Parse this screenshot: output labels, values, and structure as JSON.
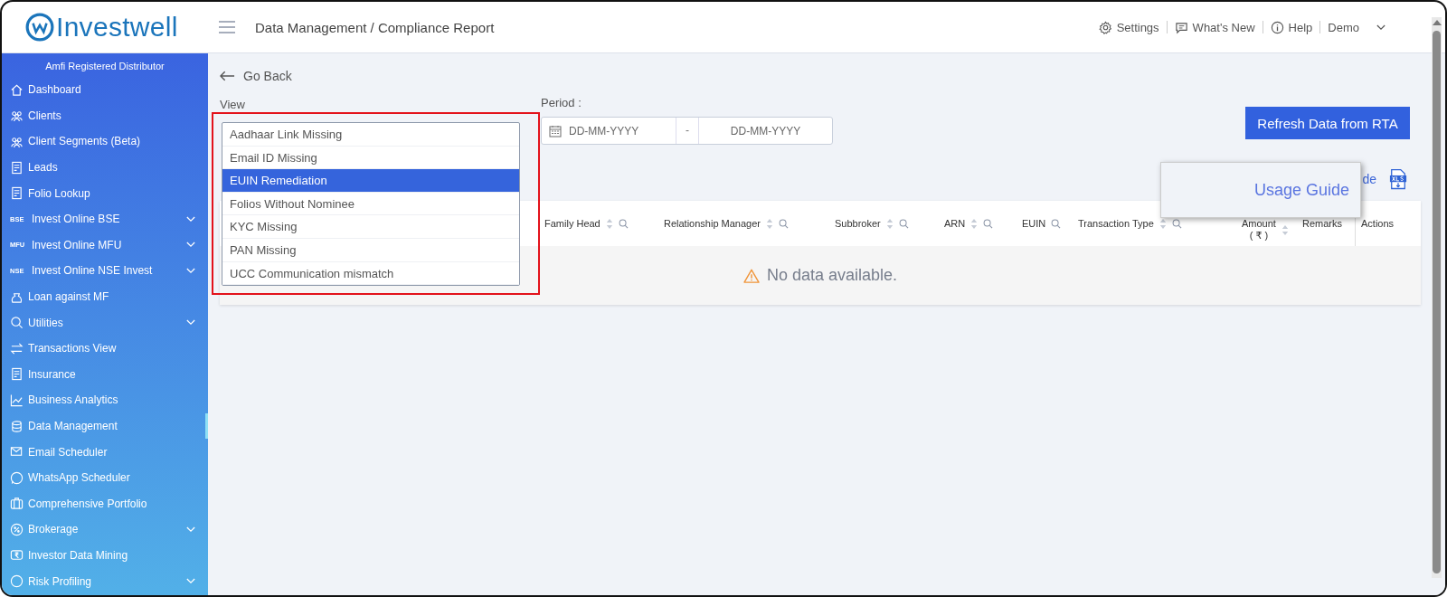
{
  "header": {
    "logo": "Investwell",
    "breadcrumb": "Data Management / Compliance Report",
    "links": [
      {
        "label": "Settings"
      },
      {
        "label": "What's New"
      },
      {
        "label": "Help"
      }
    ],
    "user": "Demo"
  },
  "sidebar": {
    "caption": "Amfi Registered Distributor",
    "items": [
      {
        "label": "Dashboard",
        "has_submenu": false,
        "selected": false
      },
      {
        "label": "Clients",
        "has_submenu": false,
        "selected": false
      },
      {
        "label": "Client Segments (Beta)",
        "has_submenu": false,
        "selected": false
      },
      {
        "label": "Leads",
        "has_submenu": false,
        "selected": false
      },
      {
        "label": "Folio Lookup",
        "has_submenu": false,
        "selected": false
      },
      {
        "label": "Invest Online BSE",
        "badge": "BSE",
        "has_submenu": true,
        "selected": false
      },
      {
        "label": "Invest Online MFU",
        "badge": "MFU",
        "has_submenu": true,
        "selected": false
      },
      {
        "label": "Invest Online NSE Invest",
        "badge": "NSE",
        "has_submenu": true,
        "selected": false
      },
      {
        "label": "Loan against MF",
        "has_submenu": false,
        "selected": false
      },
      {
        "label": "Utilities",
        "has_submenu": true,
        "selected": false
      },
      {
        "label": "Transactions View",
        "has_submenu": false,
        "selected": false
      },
      {
        "label": "Insurance",
        "has_submenu": false,
        "selected": false
      },
      {
        "label": "Business Analytics",
        "has_submenu": false,
        "selected": false
      },
      {
        "label": "Data Management",
        "has_submenu": false,
        "selected": true
      },
      {
        "label": "Email Scheduler",
        "has_submenu": false,
        "selected": false
      },
      {
        "label": "WhatsApp Scheduler",
        "has_submenu": false,
        "selected": false
      },
      {
        "label": "Comprehensive Portfolio",
        "has_submenu": false,
        "selected": false
      },
      {
        "label": "Brokerage",
        "has_submenu": true,
        "selected": false
      },
      {
        "label": "Investor Data Mining",
        "has_submenu": false,
        "selected": false
      },
      {
        "label": "Risk Profiling",
        "has_submenu": true,
        "selected": false
      }
    ]
  },
  "go_back": "Go Back",
  "view": {
    "label": "View",
    "highlighted": true,
    "options": [
      {
        "label": "Aadhaar Link Missing",
        "selected": false
      },
      {
        "label": "Email ID Missing",
        "selected": false
      },
      {
        "label": "EUIN Remediation",
        "selected": true
      },
      {
        "label": "Folios Without Nominee",
        "selected": false
      },
      {
        "label": "KYC Missing",
        "selected": false
      },
      {
        "label": "PAN Missing",
        "selected": false
      },
      {
        "label": "UCC Communication mismatch",
        "selected": false
      }
    ]
  },
  "period": {
    "label": "Period :",
    "from": {
      "placeholder": "DD-MM-YYYY"
    },
    "separator": "-",
    "to": {
      "placeholder": "DD-MM-YYYY"
    }
  },
  "refresh_button": "Refresh Data from RTA",
  "usage_link_tail": "de",
  "usage_guide_popup": {
    "label": "Usage Guide"
  },
  "table": {
    "columns": [
      {
        "label": "Family Head",
        "sortable": true,
        "searchable": true
      },
      {
        "label": "Relationship Manager",
        "sortable": true,
        "searchable": true
      },
      {
        "label": "Subbroker",
        "sortable": true,
        "searchable": true
      },
      {
        "label": "ARN",
        "sortable": true,
        "searchable": true
      },
      {
        "label": "EUIN",
        "sortable": false,
        "searchable": true
      },
      {
        "label": "Transaction Type",
        "sortable": true,
        "searchable": true
      },
      {
        "label": "Amount",
        "sub": "( ₹ )",
        "sortable": true,
        "searchable": false
      },
      {
        "label": "Remarks",
        "sortable": false,
        "searchable": false
      },
      {
        "label": "Actions",
        "sortable": false,
        "searchable": false
      }
    ],
    "empty_message": "No data available."
  }
}
